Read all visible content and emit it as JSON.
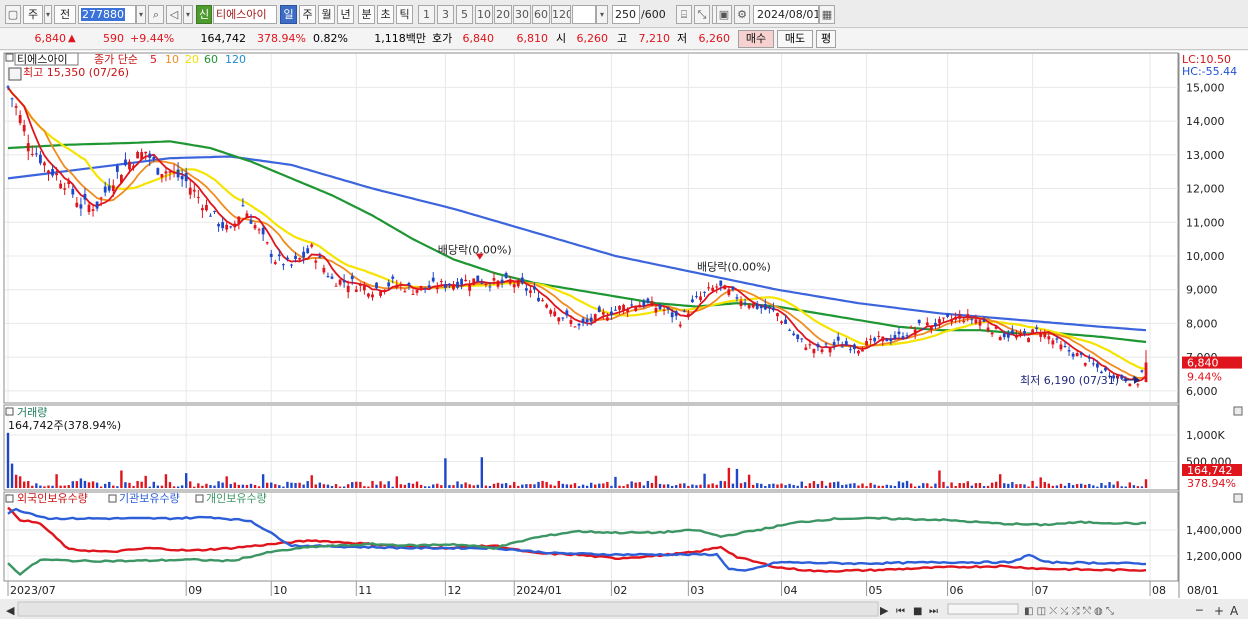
{
  "toolbar": {
    "period": "주",
    "prev": "전",
    "code": "277880",
    "badge_new": "신",
    "stock_name": "티에스아이",
    "intervals": [
      "일",
      "주",
      "월",
      "년",
      "분",
      "초",
      "틱"
    ],
    "selected_interval": "일",
    "minute_steps": [
      "1",
      "3",
      "5",
      "10",
      "20",
      "30",
      "60",
      "120"
    ],
    "count": "250",
    "count_total": "/600",
    "date": "2024/08/01"
  },
  "quote": {
    "price": "6,840",
    "change_arrow": "▲",
    "change": "590",
    "change_pct": "+9.44%",
    "volume": "164,742",
    "volume_ratio": "378.94%",
    "turnover": "0.82%",
    "amount": "1,118백만",
    "hoga_label": "호가",
    "ask": "6,840",
    "bid": "6,810",
    "open_label": "시",
    "open": "6,260",
    "high_label": "고",
    "high": "7,210",
    "low_label": "저",
    "low": "6,260",
    "buy_label": "매수",
    "sell_label": "매도",
    "flat_label": "평"
  },
  "chart_data": [
    {
      "type": "candlestick",
      "name": "price",
      "legend": {
        "stock": "티에스아이",
        "ma_label": "종가 단순",
        "ma_periods": [
          "5",
          "10",
          "20",
          "60",
          "120"
        ],
        "ma_colors": [
          "#e0141c",
          "#f08c1e",
          "#f0e000",
          "#1e9632",
          "#1e8cd2"
        ]
      },
      "y_ticks": [
        "15,000",
        "14,000",
        "13,000",
        "12,000",
        "11,000",
        "10,000",
        "9,000",
        "8,000",
        "7,000",
        "6,000"
      ],
      "y_tick_values": [
        15000,
        14000,
        13000,
        12000,
        11000,
        10000,
        9000,
        8000,
        7000,
        6000
      ],
      "ylim": [
        5700,
        15900
      ],
      "x_ticks": [
        "2023/07",
        "09",
        "10",
        "11",
        "12",
        "2024/01",
        "02",
        "03",
        "04",
        "05",
        "06",
        "07",
        "08"
      ],
      "x_tick_days": [
        0,
        44,
        65,
        86,
        108,
        125,
        149,
        168,
        191,
        212,
        232,
        253,
        282
      ],
      "right_edge_label": "08/01",
      "lc_label": "LC:10.50",
      "hc_label": "HC:-55.44",
      "highest_label": "최고 15,350 (07/26)",
      "lowest_label": "최저 6,190 (07/31)",
      "dividend_label": "배당락(0.00%)",
      "dividend_days": [
        116,
        180
      ],
      "last_price_tag": "6,840",
      "last_pct_tag": "9.44%",
      "last_value": 6840,
      "anchors": [
        {
          "d": 0,
          "p": 15000
        },
        {
          "d": 3,
          "p": 14100
        },
        {
          "d": 6,
          "p": 13200
        },
        {
          "d": 10,
          "p": 12600
        },
        {
          "d": 14,
          "p": 12200
        },
        {
          "d": 18,
          "p": 11500
        },
        {
          "d": 22,
          "p": 11500
        },
        {
          "d": 26,
          "p": 12300
        },
        {
          "d": 30,
          "p": 12800
        },
        {
          "d": 34,
          "p": 13100
        },
        {
          "d": 37,
          "p": 12600
        },
        {
          "d": 40,
          "p": 12500
        },
        {
          "d": 44,
          "p": 12200
        },
        {
          "d": 48,
          "p": 11600
        },
        {
          "d": 52,
          "p": 11000
        },
        {
          "d": 55,
          "p": 10700
        },
        {
          "d": 58,
          "p": 11500
        },
        {
          "d": 62,
          "p": 10700
        },
        {
          "d": 66,
          "p": 9900
        },
        {
          "d": 70,
          "p": 9700
        },
        {
          "d": 75,
          "p": 10200
        },
        {
          "d": 80,
          "p": 9300
        },
        {
          "d": 85,
          "p": 9200
        },
        {
          "d": 90,
          "p": 9000
        },
        {
          "d": 95,
          "p": 9200
        },
        {
          "d": 100,
          "p": 9000
        },
        {
          "d": 105,
          "p": 9100
        },
        {
          "d": 110,
          "p": 9200
        },
        {
          "d": 116,
          "p": 9300
        },
        {
          "d": 120,
          "p": 9200
        },
        {
          "d": 125,
          "p": 9200
        },
        {
          "d": 130,
          "p": 8900
        },
        {
          "d": 136,
          "p": 8300
        },
        {
          "d": 141,
          "p": 7900
        },
        {
          "d": 146,
          "p": 8200
        },
        {
          "d": 152,
          "p": 8500
        },
        {
          "d": 157,
          "p": 8600
        },
        {
          "d": 162,
          "p": 8400
        },
        {
          "d": 166,
          "p": 8100
        },
        {
          "d": 170,
          "p": 8700
        },
        {
          "d": 175,
          "p": 9100
        },
        {
          "d": 180,
          "p": 8800
        },
        {
          "d": 185,
          "p": 8500
        },
        {
          "d": 190,
          "p": 8300
        },
        {
          "d": 195,
          "p": 7500
        },
        {
          "d": 200,
          "p": 7200
        },
        {
          "d": 205,
          "p": 7400
        },
        {
          "d": 210,
          "p": 7300
        },
        {
          "d": 215,
          "p": 7500
        },
        {
          "d": 220,
          "p": 7600
        },
        {
          "d": 225,
          "p": 7900
        },
        {
          "d": 230,
          "p": 8000
        },
        {
          "d": 235,
          "p": 8200
        },
        {
          "d": 240,
          "p": 8100
        },
        {
          "d": 245,
          "p": 7700
        },
        {
          "d": 250,
          "p": 7600
        },
        {
          "d": 255,
          "p": 7800
        },
        {
          "d": 260,
          "p": 7300
        },
        {
          "d": 265,
          "p": 7000
        },
        {
          "d": 270,
          "p": 6600
        },
        {
          "d": 275,
          "p": 6400
        },
        {
          "d": 279,
          "p": 6250
        },
        {
          "d": 281,
          "p": 6840
        }
      ],
      "ma120": [
        {
          "d": 0,
          "p": 12300
        },
        {
          "d": 20,
          "p": 12600
        },
        {
          "d": 40,
          "p": 12900
        },
        {
          "d": 55,
          "p": 12950
        },
        {
          "d": 70,
          "p": 12700
        },
        {
          "d": 90,
          "p": 12000
        },
        {
          "d": 110,
          "p": 11400
        },
        {
          "d": 130,
          "p": 10700
        },
        {
          "d": 150,
          "p": 10000
        },
        {
          "d": 170,
          "p": 9500
        },
        {
          "d": 190,
          "p": 9000
        },
        {
          "d": 210,
          "p": 8600
        },
        {
          "d": 230,
          "p": 8300
        },
        {
          "d": 250,
          "p": 8100
        },
        {
          "d": 270,
          "p": 7900
        },
        {
          "d": 281,
          "p": 7800
        }
      ],
      "ma60": [
        {
          "d": 0,
          "p": 13200
        },
        {
          "d": 15,
          "p": 13300
        },
        {
          "d": 30,
          "p": 13350
        },
        {
          "d": 40,
          "p": 13400
        },
        {
          "d": 50,
          "p": 13200
        },
        {
          "d": 60,
          "p": 12800
        },
        {
          "d": 70,
          "p": 12300
        },
        {
          "d": 80,
          "p": 11800
        },
        {
          "d": 90,
          "p": 11200
        },
        {
          "d": 100,
          "p": 10500
        },
        {
          "d": 110,
          "p": 9900
        },
        {
          "d": 120,
          "p": 9500
        },
        {
          "d": 130,
          "p": 9200
        },
        {
          "d": 140,
          "p": 9000
        },
        {
          "d": 150,
          "p": 8800
        },
        {
          "d": 160,
          "p": 8600
        },
        {
          "d": 170,
          "p": 8500
        },
        {
          "d": 180,
          "p": 8600
        },
        {
          "d": 190,
          "p": 8500
        },
        {
          "d": 200,
          "p": 8300
        },
        {
          "d": 210,
          "p": 8100
        },
        {
          "d": 220,
          "p": 7900
        },
        {
          "d": 230,
          "p": 7800
        },
        {
          "d": 240,
          "p": 7800
        },
        {
          "d": 250,
          "p": 7700
        },
        {
          "d": 260,
          "p": 7700
        },
        {
          "d": 270,
          "p": 7600
        },
        {
          "d": 281,
          "p": 7450
        }
      ],
      "volume_panel": {
        "label": "거래량",
        "readout": "164,742주(378.94%)",
        "y_ticks": [
          "1,000K",
          "500,000"
        ],
        "y_tick_values": [
          1000000,
          500000
        ],
        "ylim": [
          0,
          1150000
        ],
        "last_volume_tag": "164,742",
        "last_ratio_tag": "378.94%",
        "spikes": [
          {
            "d": 0,
            "v": 1040000
          },
          {
            "d": 1,
            "v": 460000
          },
          {
            "d": 2,
            "v": 250000
          },
          {
            "d": 3,
            "v": 220000
          },
          {
            "d": 12,
            "v": 260000
          },
          {
            "d": 18,
            "v": 180000
          },
          {
            "d": 28,
            "v": 330000
          },
          {
            "d": 34,
            "v": 230000
          },
          {
            "d": 39,
            "v": 260000
          },
          {
            "d": 44,
            "v": 280000
          },
          {
            "d": 54,
            "v": 220000
          },
          {
            "d": 63,
            "v": 260000
          },
          {
            "d": 75,
            "v": 240000
          },
          {
            "d": 96,
            "v": 220000
          },
          {
            "d": 108,
            "v": 560000
          },
          {
            "d": 117,
            "v": 580000
          },
          {
            "d": 150,
            "v": 210000
          },
          {
            "d": 160,
            "v": 230000
          },
          {
            "d": 172,
            "v": 270000
          },
          {
            "d": 178,
            "v": 380000
          },
          {
            "d": 180,
            "v": 360000
          },
          {
            "d": 183,
            "v": 250000
          },
          {
            "d": 230,
            "v": 330000
          },
          {
            "d": 245,
            "v": 260000
          },
          {
            "d": 255,
            "v": 200000
          },
          {
            "d": 281,
            "v": 165000
          }
        ]
      }
    },
    {
      "type": "line",
      "name": "ownership",
      "series": [
        {
          "name": "외국인보유수량",
          "color": "#e0141c",
          "values": [
            {
              "d": 0,
              "p": 1570000
            },
            {
              "d": 3,
              "p": 1480000
            },
            {
              "d": 8,
              "p": 1450000
            },
            {
              "d": 15,
              "p": 1250000
            },
            {
              "d": 25,
              "p": 1230000
            },
            {
              "d": 35,
              "p": 1260000
            },
            {
              "d": 45,
              "p": 1240000
            },
            {
              "d": 55,
              "p": 1260000
            },
            {
              "d": 65,
              "p": 1290000
            },
            {
              "d": 75,
              "p": 1320000
            },
            {
              "d": 90,
              "p": 1290000
            },
            {
              "d": 100,
              "p": 1270000
            },
            {
              "d": 110,
              "p": 1260000
            },
            {
              "d": 120,
              "p": 1280000
            },
            {
              "d": 130,
              "p": 1220000
            },
            {
              "d": 140,
              "p": 1210000
            },
            {
              "d": 150,
              "p": 1180000
            },
            {
              "d": 160,
              "p": 1200000
            },
            {
              "d": 170,
              "p": 1230000
            },
            {
              "d": 176,
              "p": 1270000
            },
            {
              "d": 180,
              "p": 1190000
            },
            {
              "d": 190,
              "p": 1110000
            },
            {
              "d": 200,
              "p": 1080000
            },
            {
              "d": 215,
              "p": 1090000
            },
            {
              "d": 230,
              "p": 1110000
            },
            {
              "d": 245,
              "p": 1120000
            },
            {
              "d": 255,
              "p": 1100000
            },
            {
              "d": 270,
              "p": 1090000
            },
            {
              "d": 281,
              "p": 1090000
            }
          ]
        },
        {
          "name": "기관보유수량",
          "color": "#2c5ed8",
          "values": [
            {
              "d": 0,
              "p": 1530000
            },
            {
              "d": 2,
              "p": 1560000
            },
            {
              "d": 10,
              "p": 1490000
            },
            {
              "d": 25,
              "p": 1490000
            },
            {
              "d": 40,
              "p": 1490000
            },
            {
              "d": 50,
              "p": 1500000
            },
            {
              "d": 60,
              "p": 1470000
            },
            {
              "d": 70,
              "p": 1280000
            },
            {
              "d": 85,
              "p": 1270000
            },
            {
              "d": 100,
              "p": 1260000
            },
            {
              "d": 120,
              "p": 1260000
            },
            {
              "d": 135,
              "p": 1220000
            },
            {
              "d": 150,
              "p": 1210000
            },
            {
              "d": 165,
              "p": 1210000
            },
            {
              "d": 175,
              "p": 1210000
            },
            {
              "d": 178,
              "p": 1100000
            },
            {
              "d": 182,
              "p": 1080000
            },
            {
              "d": 190,
              "p": 1150000
            },
            {
              "d": 210,
              "p": 1140000
            },
            {
              "d": 230,
              "p": 1150000
            },
            {
              "d": 248,
              "p": 1150000
            },
            {
              "d": 252,
              "p": 1210000
            },
            {
              "d": 256,
              "p": 1150000
            },
            {
              "d": 281,
              "p": 1140000
            }
          ]
        },
        {
          "name": "개인보유수량",
          "color": "#3c9664",
          "values": [
            {
              "d": 0,
              "p": 1140000
            },
            {
              "d": 3,
              "p": 1060000
            },
            {
              "d": 8,
              "p": 1170000
            },
            {
              "d": 18,
              "p": 1160000
            },
            {
              "d": 30,
              "p": 1160000
            },
            {
              "d": 45,
              "p": 1170000
            },
            {
              "d": 55,
              "p": 1160000
            },
            {
              "d": 65,
              "p": 1230000
            },
            {
              "d": 75,
              "p": 1270000
            },
            {
              "d": 90,
              "p": 1290000
            },
            {
              "d": 100,
              "p": 1280000
            },
            {
              "d": 110,
              "p": 1290000
            },
            {
              "d": 120,
              "p": 1260000
            },
            {
              "d": 130,
              "p": 1340000
            },
            {
              "d": 140,
              "p": 1390000
            },
            {
              "d": 150,
              "p": 1380000
            },
            {
              "d": 160,
              "p": 1380000
            },
            {
              "d": 170,
              "p": 1400000
            },
            {
              "d": 176,
              "p": 1350000
            },
            {
              "d": 185,
              "p": 1400000
            },
            {
              "d": 195,
              "p": 1460000
            },
            {
              "d": 205,
              "p": 1490000
            },
            {
              "d": 215,
              "p": 1490000
            },
            {
              "d": 230,
              "p": 1480000
            },
            {
              "d": 245,
              "p": 1450000
            },
            {
              "d": 255,
              "p": 1440000
            },
            {
              "d": 265,
              "p": 1460000
            },
            {
              "d": 281,
              "p": 1450000
            }
          ]
        }
      ],
      "y_ticks": [
        "1,400,000",
        "1,200,000"
      ],
      "y_tick_values": [
        1400000,
        1200000
      ],
      "ylim": [
        1020000,
        1610000
      ]
    }
  ],
  "colors": {
    "up": "#e0141c",
    "down": "#1e46c8",
    "grid": "#e8e8e8",
    "axis_bg": "#ffffff",
    "tag_bg": "#e0141c"
  },
  "scroll": {
    "nav_glyphs": [
      "▶",
      "⏮",
      "■",
      "⏭"
    ],
    "zoom_glyphs": [
      "─",
      "+",
      "A"
    ]
  }
}
